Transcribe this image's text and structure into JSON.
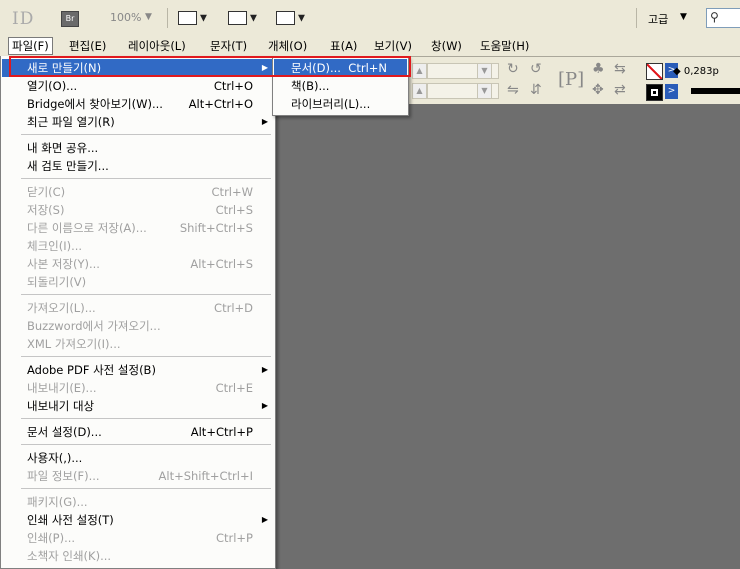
{
  "appbar": {
    "logo": "ID",
    "bridge_label": "Br",
    "zoom": "100%",
    "workspace": "고급"
  },
  "menubar": [
    {
      "label": "파일(F)",
      "active": true
    },
    {
      "label": "편집(E)"
    },
    {
      "label": "레이아웃(L)"
    },
    {
      "label": "문자(T)"
    },
    {
      "label": "개체(O)"
    },
    {
      "label": "표(A)"
    },
    {
      "label": "보기(V)"
    },
    {
      "label": "창(W)"
    },
    {
      "label": "도움말(H)"
    }
  ],
  "control_bar": {
    "stroke_value": "0,283p"
  },
  "file_menu": [
    {
      "label": "새로 만들기(N)",
      "shortcut": "",
      "submenu": true,
      "disabled": false,
      "highlighted": true
    },
    {
      "label": "열기(O)...",
      "shortcut": "Ctrl+O",
      "disabled": false
    },
    {
      "label": "Bridge에서 찾아보기(W)...",
      "shortcut": "Alt+Ctrl+O",
      "disabled": false
    },
    {
      "label": "최근 파일 열기(R)",
      "shortcut": "",
      "submenu": true,
      "disabled": false
    },
    {
      "divider": true
    },
    {
      "label": "내 화면 공유...",
      "shortcut": "",
      "disabled": false
    },
    {
      "label": "새 검토 만들기...",
      "shortcut": "",
      "disabled": false
    },
    {
      "divider": true
    },
    {
      "label": "닫기(C)",
      "shortcut": "Ctrl+W",
      "disabled": true
    },
    {
      "label": "저장(S)",
      "shortcut": "Ctrl+S",
      "disabled": true
    },
    {
      "label": "다른 이름으로 저장(A)...",
      "shortcut": "Shift+Ctrl+S",
      "disabled": true
    },
    {
      "label": "체크인(I)...",
      "shortcut": "",
      "disabled": true
    },
    {
      "label": "사본 저장(Y)...",
      "shortcut": "Alt+Ctrl+S",
      "disabled": true
    },
    {
      "label": "되돌리기(V)",
      "shortcut": "",
      "disabled": true
    },
    {
      "divider": true
    },
    {
      "label": "가져오기(L)...",
      "shortcut": "Ctrl+D",
      "disabled": true
    },
    {
      "label": "Buzzword에서 가져오기...",
      "shortcut": "",
      "disabled": true
    },
    {
      "label": "XML 가져오기(I)...",
      "shortcut": "",
      "disabled": true
    },
    {
      "divider": true
    },
    {
      "label": "Adobe PDF 사전 설정(B)",
      "shortcut": "",
      "submenu": true,
      "disabled": false
    },
    {
      "label": "내보내기(E)...",
      "shortcut": "Ctrl+E",
      "disabled": true
    },
    {
      "label": "내보내기 대상",
      "shortcut": "",
      "submenu": true,
      "disabled": false
    },
    {
      "divider": true
    },
    {
      "label": "문서 설정(D)...",
      "shortcut": "Alt+Ctrl+P",
      "disabled": false
    },
    {
      "divider": true
    },
    {
      "label": "사용자(,)...",
      "shortcut": "",
      "disabled": false
    },
    {
      "label": "파일 정보(F)...",
      "shortcut": "Alt+Shift+Ctrl+I",
      "disabled": true
    },
    {
      "divider": true
    },
    {
      "label": "패키지(G)...",
      "shortcut": "",
      "disabled": true
    },
    {
      "label": "인쇄 사전 설정(T)",
      "shortcut": "",
      "submenu": true,
      "disabled": false
    },
    {
      "label": "인쇄(P)...",
      "shortcut": "Ctrl+P",
      "disabled": true
    },
    {
      "label": "소책자 인쇄(K)...",
      "shortcut": "",
      "disabled": true
    }
  ],
  "new_submenu": [
    {
      "label": "문서(D)...",
      "shortcut": "Ctrl+N",
      "highlighted": true
    },
    {
      "label": "책(B)...",
      "shortcut": ""
    },
    {
      "label": "라이브러리(L)...",
      "shortcut": ""
    }
  ],
  "colors": {
    "highlight": "#316ac5",
    "callout": "#e0191e",
    "canvas": "#6e6e6e",
    "chrome": "#ece9d8"
  }
}
